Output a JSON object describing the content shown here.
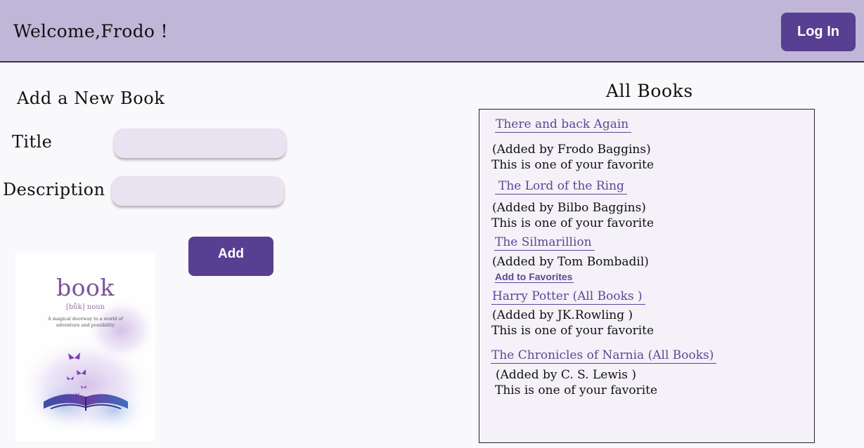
{
  "header": {
    "welcome": "Welcome,Frodo !",
    "login_label": "Log In"
  },
  "add_form": {
    "title": "Add a New Book",
    "title_label": "Title",
    "title_value": "",
    "description_label": "Description",
    "description_value": "",
    "add_label": "Add"
  },
  "cover_image": {
    "word": "book",
    "phonetic": "[bůk] noun",
    "definition": "A magical doorway to a world of adventure and possibility"
  },
  "all_books": {
    "title": "All Books",
    "items": [
      {
        "title": "There and back Again",
        "added_by": "(Added by Frodo Baggins)",
        "status": "This is one of your favorite"
      },
      {
        "title": "The Lord of the Ring",
        "added_by": "(Added by Bilbo Baggins)",
        "status": "This is one of your favorite"
      },
      {
        "title": "The Silmarillion",
        "added_by": "(Added by Tom Bombadil)",
        "action": "Add to Favorites"
      },
      {
        "title": "Harry Potter (All Books )",
        "added_by": "(Added by JK.Rowling )",
        "status": "This is one of your favorite"
      },
      {
        "title": "The Chronicles of Narnia (All Books)",
        "added_by": "(Added by C. S. Lewis )",
        "status": "This is one of your favorite"
      }
    ]
  },
  "colors": {
    "header_bg": "#c0b6d8",
    "accent": "#583f91",
    "link": "#5b4796",
    "input_bg": "#e8e2f1"
  }
}
